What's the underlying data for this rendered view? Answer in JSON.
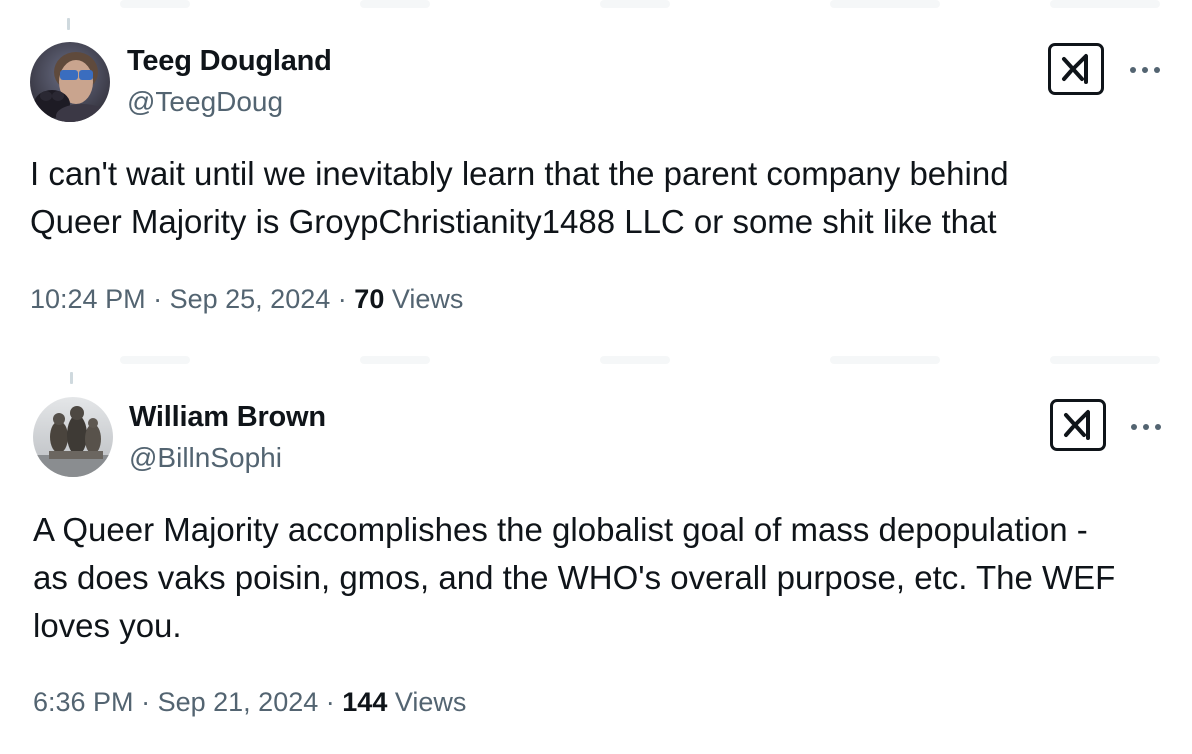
{
  "tweets": [
    {
      "author_name": "Teeg Dougland",
      "handle": "@TeegDoug",
      "text": "I can't wait until we inevitably learn that the parent company behind\nQueer Majority is GroypChristianity1488 LLC or some shit like that",
      "time": "10:24 PM",
      "separator": "·",
      "date": "Sep 25, 2024",
      "views_count": "70",
      "views_label": "Views"
    },
    {
      "author_name": "William Brown",
      "handle": "@BillnSophi",
      "text": "A Queer Majority accomplishes the globalist goal of mass depopulation -\nas does vaks poisin, gmos, and the WHO's overall purpose, etc.  The WEF\nloves you.",
      "time": "6:36 PM",
      "separator": "·",
      "date": "Sep 21, 2024",
      "views_count": "144",
      "views_label": "Views"
    }
  ],
  "icons": {
    "grok": "grok-icon",
    "more": "more-horizontal-icon"
  },
  "colors": {
    "text_primary": "#0f1419",
    "text_secondary": "#536471",
    "thread_line": "#cfd9de"
  }
}
